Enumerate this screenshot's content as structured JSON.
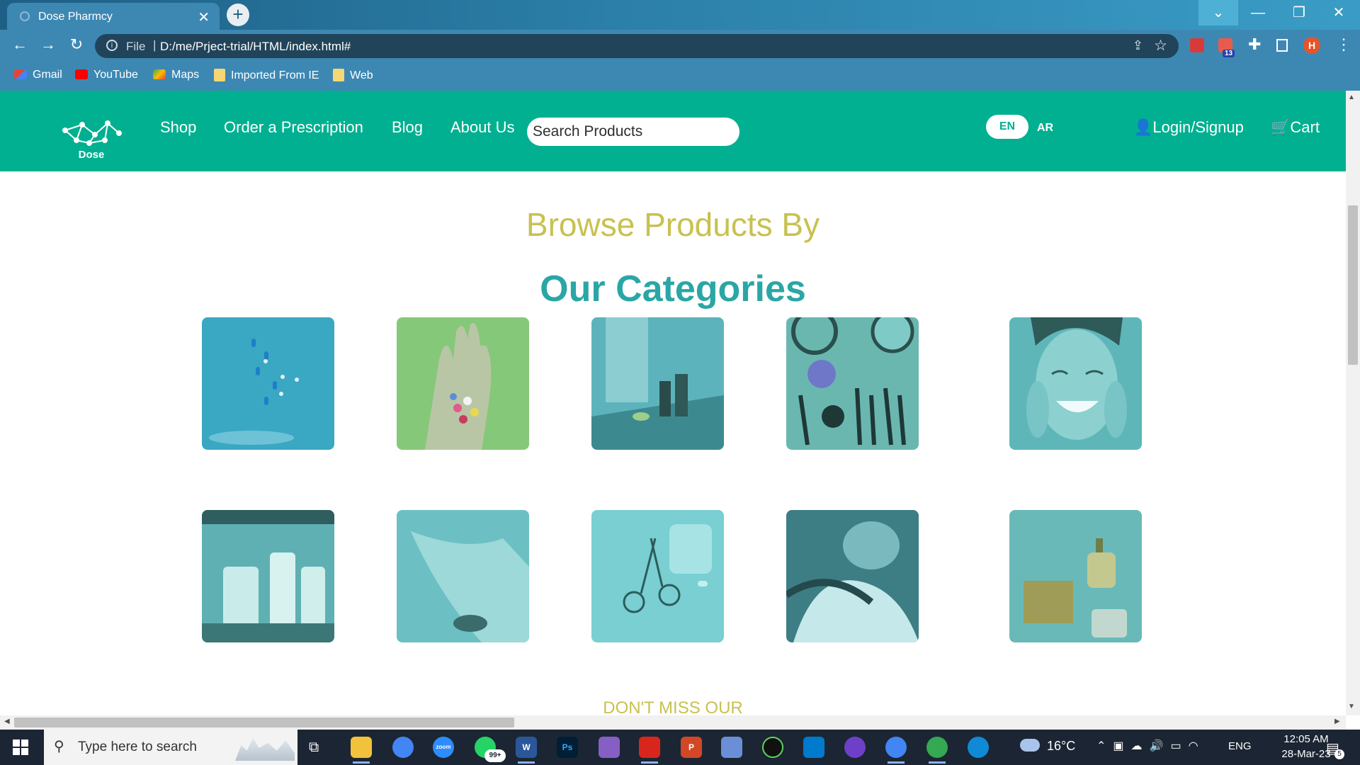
{
  "browser": {
    "tab_title": "Dose Pharmcy",
    "new_tab": "+",
    "address_prefix": "File",
    "url": "D:/me/Prject-trial/HTML/index.html#",
    "extension_badge": "13",
    "profile_initial": "H",
    "bookmarks": [
      "Gmail",
      "YouTube",
      "Maps",
      "Imported From IE",
      "Web"
    ]
  },
  "header": {
    "logo_text": "Dose",
    "nav": [
      "Shop",
      "Order a Prescription",
      "Blog",
      "About Us"
    ],
    "search_placeholder": "Search Products",
    "lang_en": "EN",
    "lang_ar": "AR",
    "login": "Login/Signup",
    "cart": "Cart",
    "brand_color": "#00b090"
  },
  "main": {
    "browse_heading": "Browse Products By",
    "categories_heading": "Our Categories",
    "categories": [
      {
        "icon": "floating-pills-image"
      },
      {
        "icon": "pills-in-hand-image"
      },
      {
        "icon": "skincare-bottles-image"
      },
      {
        "icon": "makeup-tools-image"
      },
      {
        "icon": "face-care-image"
      },
      {
        "icon": "cleaning-bottles-image"
      },
      {
        "icon": "baby-care-image"
      },
      {
        "icon": "medical-supplies-image"
      },
      {
        "icon": "hair-care-image"
      },
      {
        "icon": "perfume-image"
      }
    ],
    "next_section_heading": "DON'T MISS OUR",
    "heading_colors": {
      "browse": "#c8c150",
      "categories": "#2aa6a6"
    }
  },
  "taskbar": {
    "search_placeholder": "Type here to search",
    "whatsapp_badge": "99+",
    "weather": "16°C",
    "language": "ENG",
    "time": "12:05 AM",
    "date": "28-Mar-23",
    "notifications": "5"
  }
}
